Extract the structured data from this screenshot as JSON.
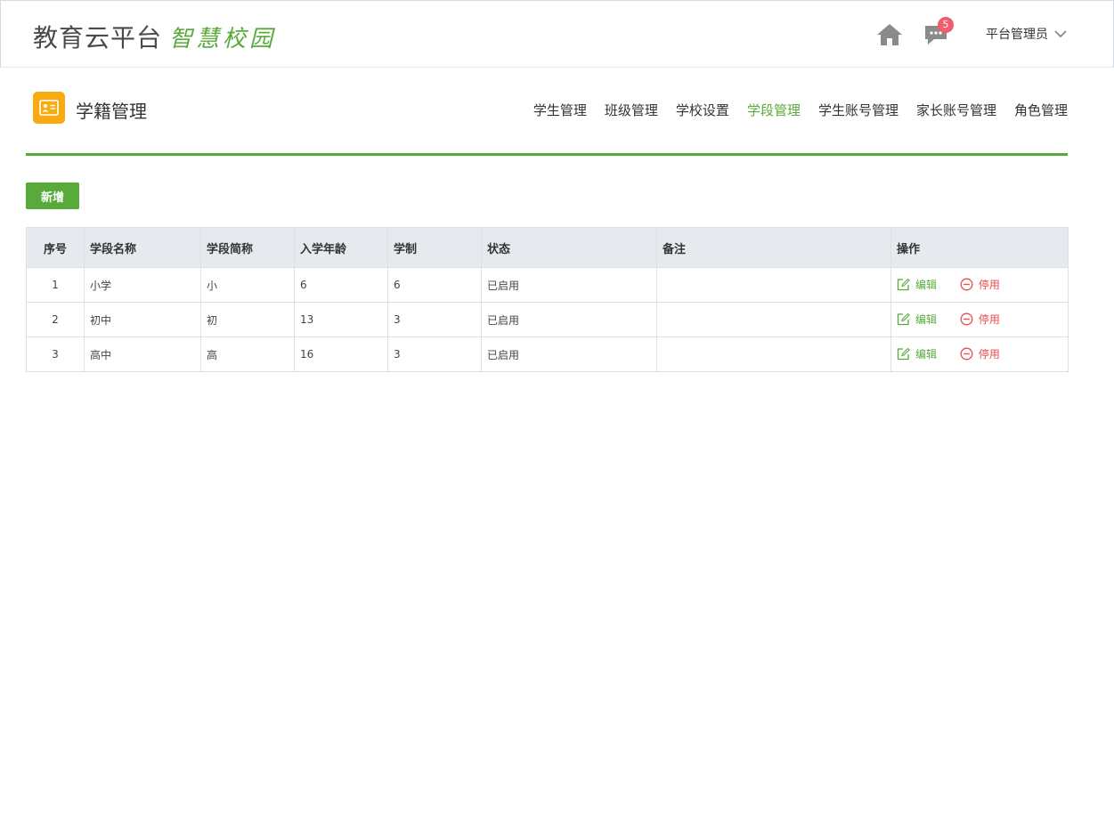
{
  "header": {
    "brand_main": "教育云平台",
    "brand_sub": "智慧校园",
    "message_count": "5",
    "user_name": "平台管理员"
  },
  "section": {
    "title": "学籍管理",
    "nav": [
      {
        "label": "学生管理",
        "active": false
      },
      {
        "label": "班级管理",
        "active": false
      },
      {
        "label": "学校设置",
        "active": false
      },
      {
        "label": "学段管理",
        "active": true
      },
      {
        "label": "学生账号管理",
        "active": false
      },
      {
        "label": "家长账号管理",
        "active": false
      },
      {
        "label": "角色管理",
        "active": false
      }
    ]
  },
  "toolbar": {
    "add_label": "新增"
  },
  "table": {
    "headers": [
      "序号",
      "学段名称",
      "学段简称",
      "入学年龄",
      "学制",
      "状态",
      "备注",
      "操作"
    ],
    "edit_label": "编辑",
    "disable_label": "停用",
    "rows": [
      {
        "idx": "1",
        "name": "小学",
        "short": "小",
        "age": "6",
        "years": "6",
        "status": "已启用",
        "note": ""
      },
      {
        "idx": "2",
        "name": "初中",
        "short": "初",
        "age": "13",
        "years": "3",
        "status": "已启用",
        "note": ""
      },
      {
        "idx": "3",
        "name": "高中",
        "short": "高",
        "age": "16",
        "years": "3",
        "status": "已启用",
        "note": ""
      }
    ]
  },
  "colors": {
    "accent_green": "#58ab3a",
    "module_icon_bg": "#f6ab10",
    "badge_red": "#f25c6e",
    "disable_red": "#e94a4a",
    "table_header_bg": "#e6e9ed"
  },
  "icons": {
    "home": "home-icon",
    "messages": "chat-bubble-icon",
    "user_menu": "chevron-down-icon",
    "module": "id-card-icon",
    "edit": "edit-icon",
    "disable": "minus-circle-icon"
  }
}
